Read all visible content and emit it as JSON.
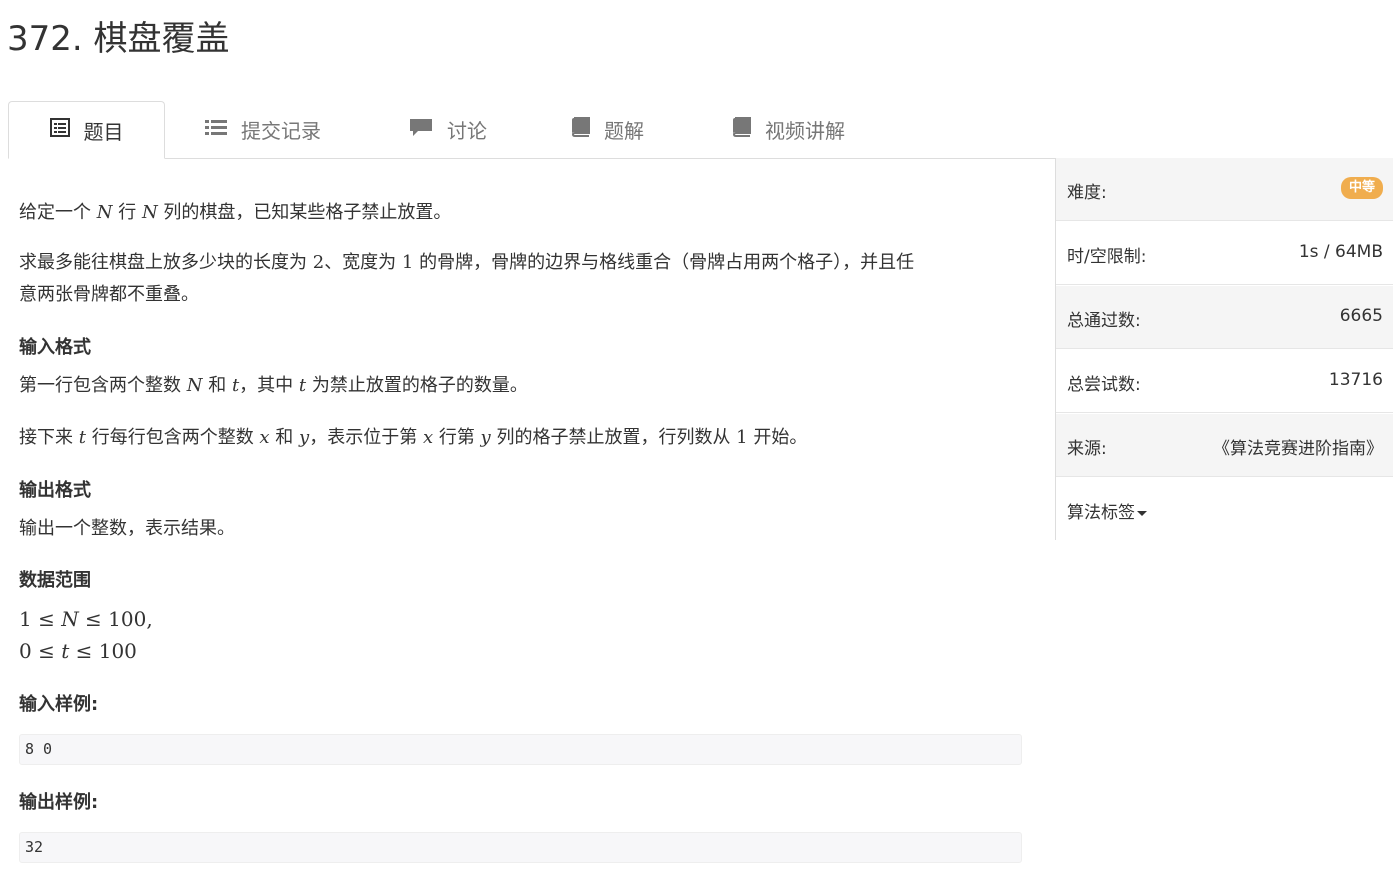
{
  "problem": {
    "title": "372. 棋盘覆盖"
  },
  "tabs": [
    {
      "label": "题目",
      "icon": "list-alt-icon"
    },
    {
      "label": "提交记录",
      "icon": "list-icon"
    },
    {
      "label": "讨论",
      "icon": "comment-icon"
    },
    {
      "label": "题解",
      "icon": "book-icon"
    },
    {
      "label": "视频讲解",
      "icon": "book-icon"
    }
  ],
  "desc": {
    "p1": {
      "a": "给定一个 ",
      "N1": "N",
      "b": " 行 ",
      "N2": "N",
      "c": " 列的棋盘，已知某些格子禁止放置。"
    },
    "p2": {
      "a": "求最多能往棋盘上放多少块的长度为 ",
      "n2": "2",
      "b": "、宽度为 ",
      "n1": "1",
      "c": " 的骨牌，骨牌的边界与格线重合（骨牌占用两个格子），并且任",
      "d": "意两张骨牌都不重叠。"
    }
  },
  "input_format": {
    "heading": "输入格式",
    "l1": {
      "a": "第一行包含两个整数 ",
      "N": "N",
      "b": " 和 ",
      "t": "t",
      "c": "，其中 ",
      "t2": "t",
      "d": " 为禁止放置的格子的数量。"
    },
    "l2": {
      "a": "接下来 ",
      "t": "t",
      "b": " 行每行包含两个整数 ",
      "x": "x",
      "c": " 和 ",
      "y": "y",
      "d": "，表示位于第 ",
      "x2": "x",
      "e": " 行第 ",
      "y2": "y",
      "f": " 列的格子禁止放置，行列数从 ",
      "one": "1",
      "g": " 开始。"
    }
  },
  "output_format": {
    "heading": "输出格式",
    "text": "输出一个整数，表示结果。"
  },
  "range": {
    "heading": "数据范围",
    "r1": {
      "a": "1 ≤ ",
      "N": "N",
      "b": " ≤ 100,"
    },
    "r2": {
      "a": "0 ≤ ",
      "t": "t",
      "b": " ≤ 100"
    }
  },
  "sample_input": {
    "heading": "输入样例:",
    "code": "8 0"
  },
  "sample_output": {
    "heading": "输出样例:",
    "code": "32"
  },
  "sidebar": {
    "difficulty_label": "难度:",
    "difficulty_value": "中等",
    "difficulty_color": "#f0ad4e",
    "limit_label": "时/空限制:",
    "limit_value": "1s / 64MB",
    "passed_label": "总通过数:",
    "passed_value": "6665",
    "tried_label": "总尝试数:",
    "tried_value": "13716",
    "source_label": "来源:",
    "source_value": "《算法竞赛进阶指南》",
    "tags_label": "算法标签"
  }
}
